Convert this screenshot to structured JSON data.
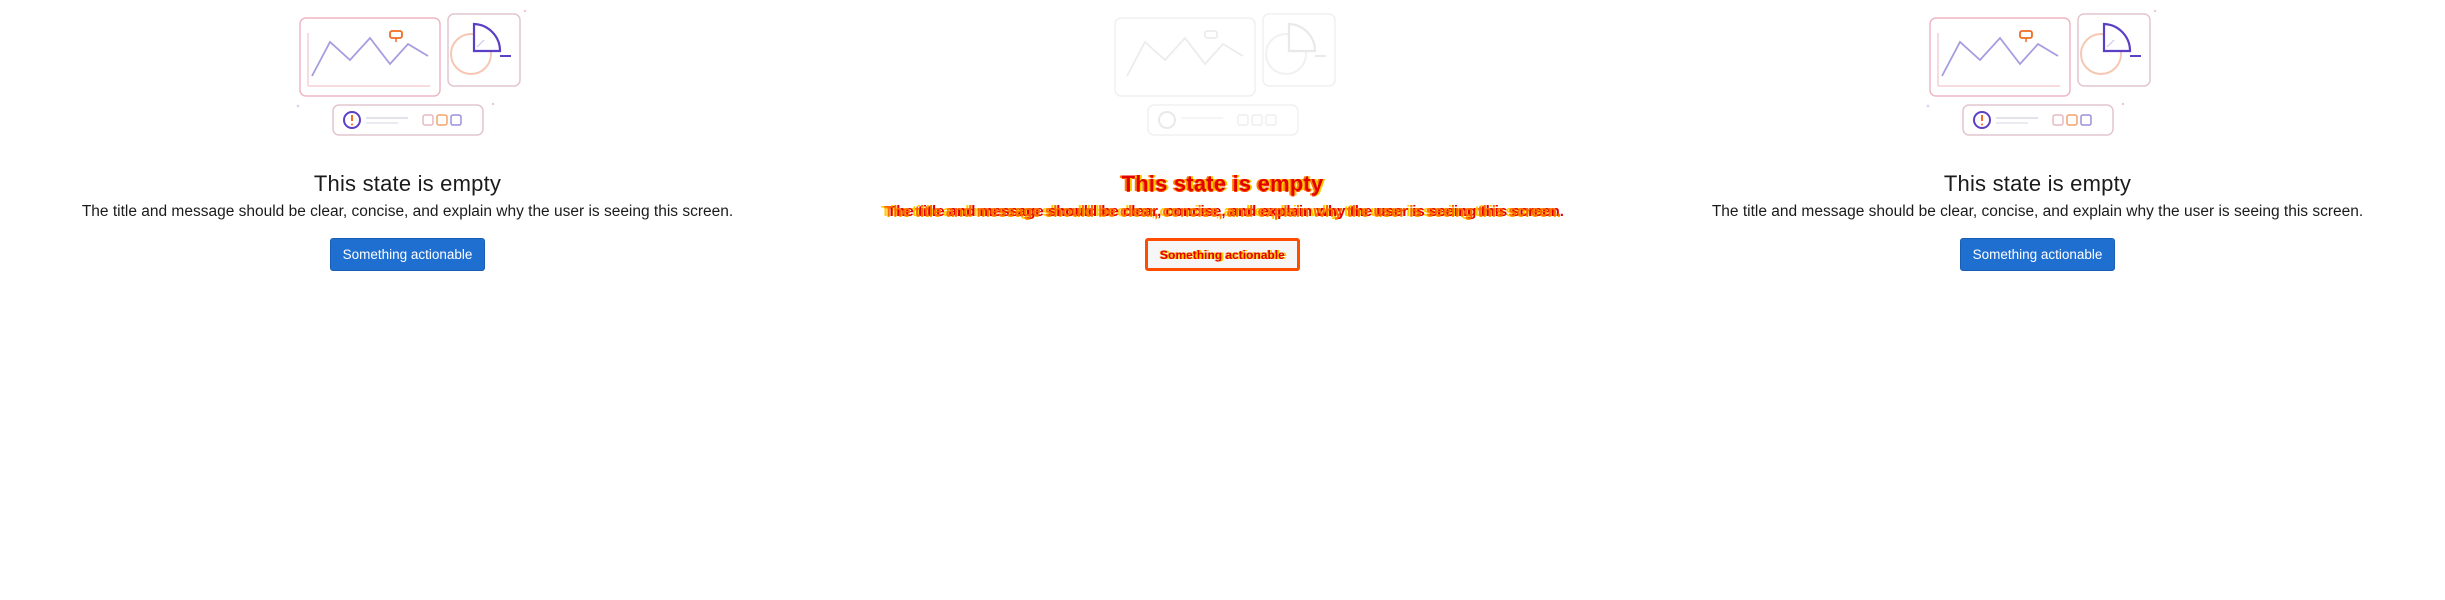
{
  "empty_state": {
    "title": "This state is empty",
    "message": "The title and message should be clear, concise, and explain why the user is seeing this screen.",
    "action_label": "Something actionable"
  },
  "colors": {
    "button_background": "#1f6fd1",
    "card_stroke": "#eeb7c3",
    "accent_purple": "#5b3fc4",
    "accent_orange": "#f26b21",
    "overlay_red": "#e20000",
    "overlay_yellow": "#ffcc00"
  },
  "icons": {
    "illustration": "empty-state-dashboard-illustration",
    "chart": "line-chart-icon",
    "pie": "pie-chart-icon",
    "alert": "alert-circle-icon"
  }
}
